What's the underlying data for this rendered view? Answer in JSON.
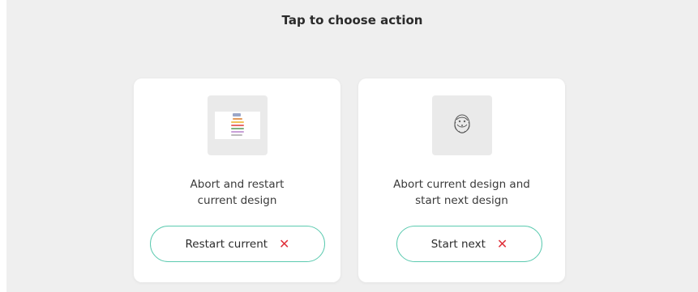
{
  "title": "Tap to choose action",
  "cards": [
    {
      "description_line1": "Abort and restart",
      "description_line2": "current design",
      "button_label": "Restart current",
      "thumbnail_icon": "design-preview-icon"
    },
    {
      "description_line1": "Abort current design and",
      "description_line2": "start next design",
      "button_label": "Start next",
      "thumbnail_icon": "embroidery-design-icon"
    }
  ],
  "colors": {
    "accent_border": "#5ccab0",
    "close_x": "#e0323c",
    "panel_bg": "#efefef",
    "card_bg": "#ffffff"
  }
}
